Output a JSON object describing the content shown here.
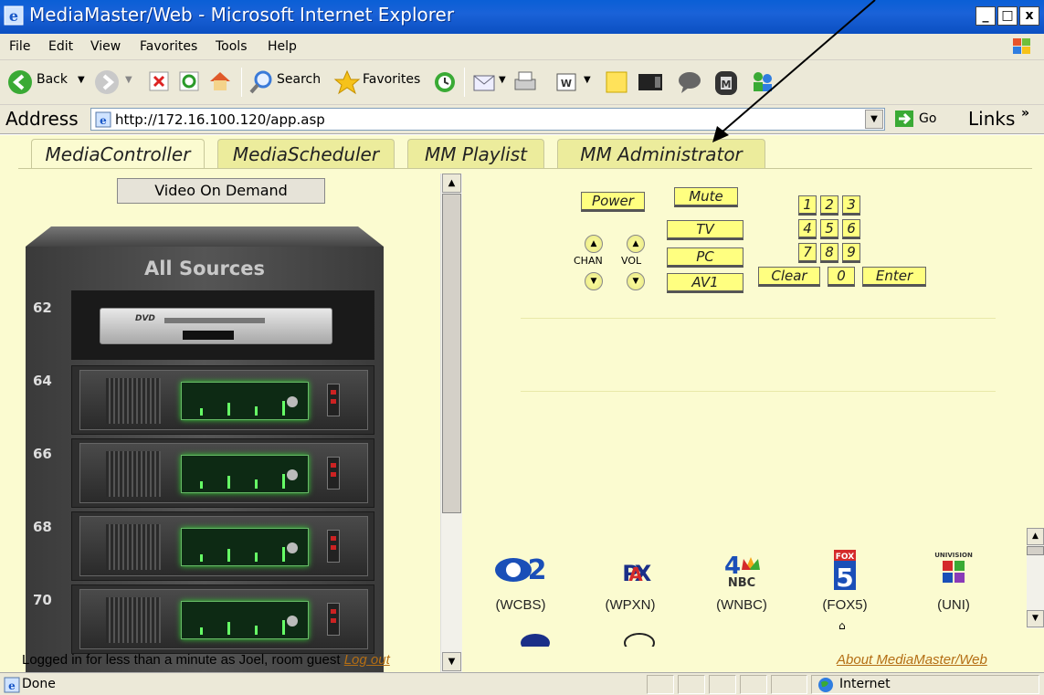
{
  "window": {
    "title": "MediaMaster/Web - Microsoft Internet Explorer",
    "minimize": "_",
    "maximize": "□",
    "close": "x"
  },
  "menu": {
    "items": [
      "File",
      "Edit",
      "View",
      "Favorites",
      "Tools",
      "Help"
    ]
  },
  "toolbar": {
    "back_label": "Back",
    "search_label": "Search",
    "favorites_label": "Favorites"
  },
  "address": {
    "label": "Address",
    "url": "http://172.16.100.120/app.asp",
    "go_label": "Go",
    "links_label": "Links"
  },
  "tabs": [
    "MediaController",
    "MediaScheduler",
    "MM Playlist",
    "MM Administrator"
  ],
  "vod_button": "Video On Demand",
  "rack": {
    "title": "All Sources",
    "slots": [
      "62",
      "64",
      "66",
      "68",
      "70"
    ]
  },
  "remote": {
    "power": "Power",
    "mute": "Mute",
    "tv": "TV",
    "pc": "PC",
    "av1": "AV1",
    "chan_label": "CHAN",
    "vol_label": "VOL",
    "digits": [
      "1",
      "2",
      "3",
      "4",
      "5",
      "6",
      "7",
      "8",
      "9"
    ],
    "clear": "Clear",
    "zero": "0",
    "enter": "Enter"
  },
  "channels": [
    {
      "logo": "CBS 2",
      "caption": "(WCBS)"
    },
    {
      "logo": "PAX",
      "caption": "(WPXN)"
    },
    {
      "logo": "4 NBC",
      "caption": "(WNBC)"
    },
    {
      "logo": "FOX 5",
      "caption": "(FOX5)"
    },
    {
      "logo": "UNIVISION",
      "caption": "(UNI)"
    }
  ],
  "footer": {
    "status_text": "Logged in for less than a minute as Joel, room guest",
    "logout": "Log out",
    "about": "About MediaMaster/Web"
  },
  "statusbar": {
    "done": "Done",
    "zone": "Internet"
  },
  "colors": {
    "content_bg": "#fbfbd0",
    "tab_bg": "#ecec9c",
    "remote_button": "#ffff80",
    "link": "#b46e14"
  }
}
